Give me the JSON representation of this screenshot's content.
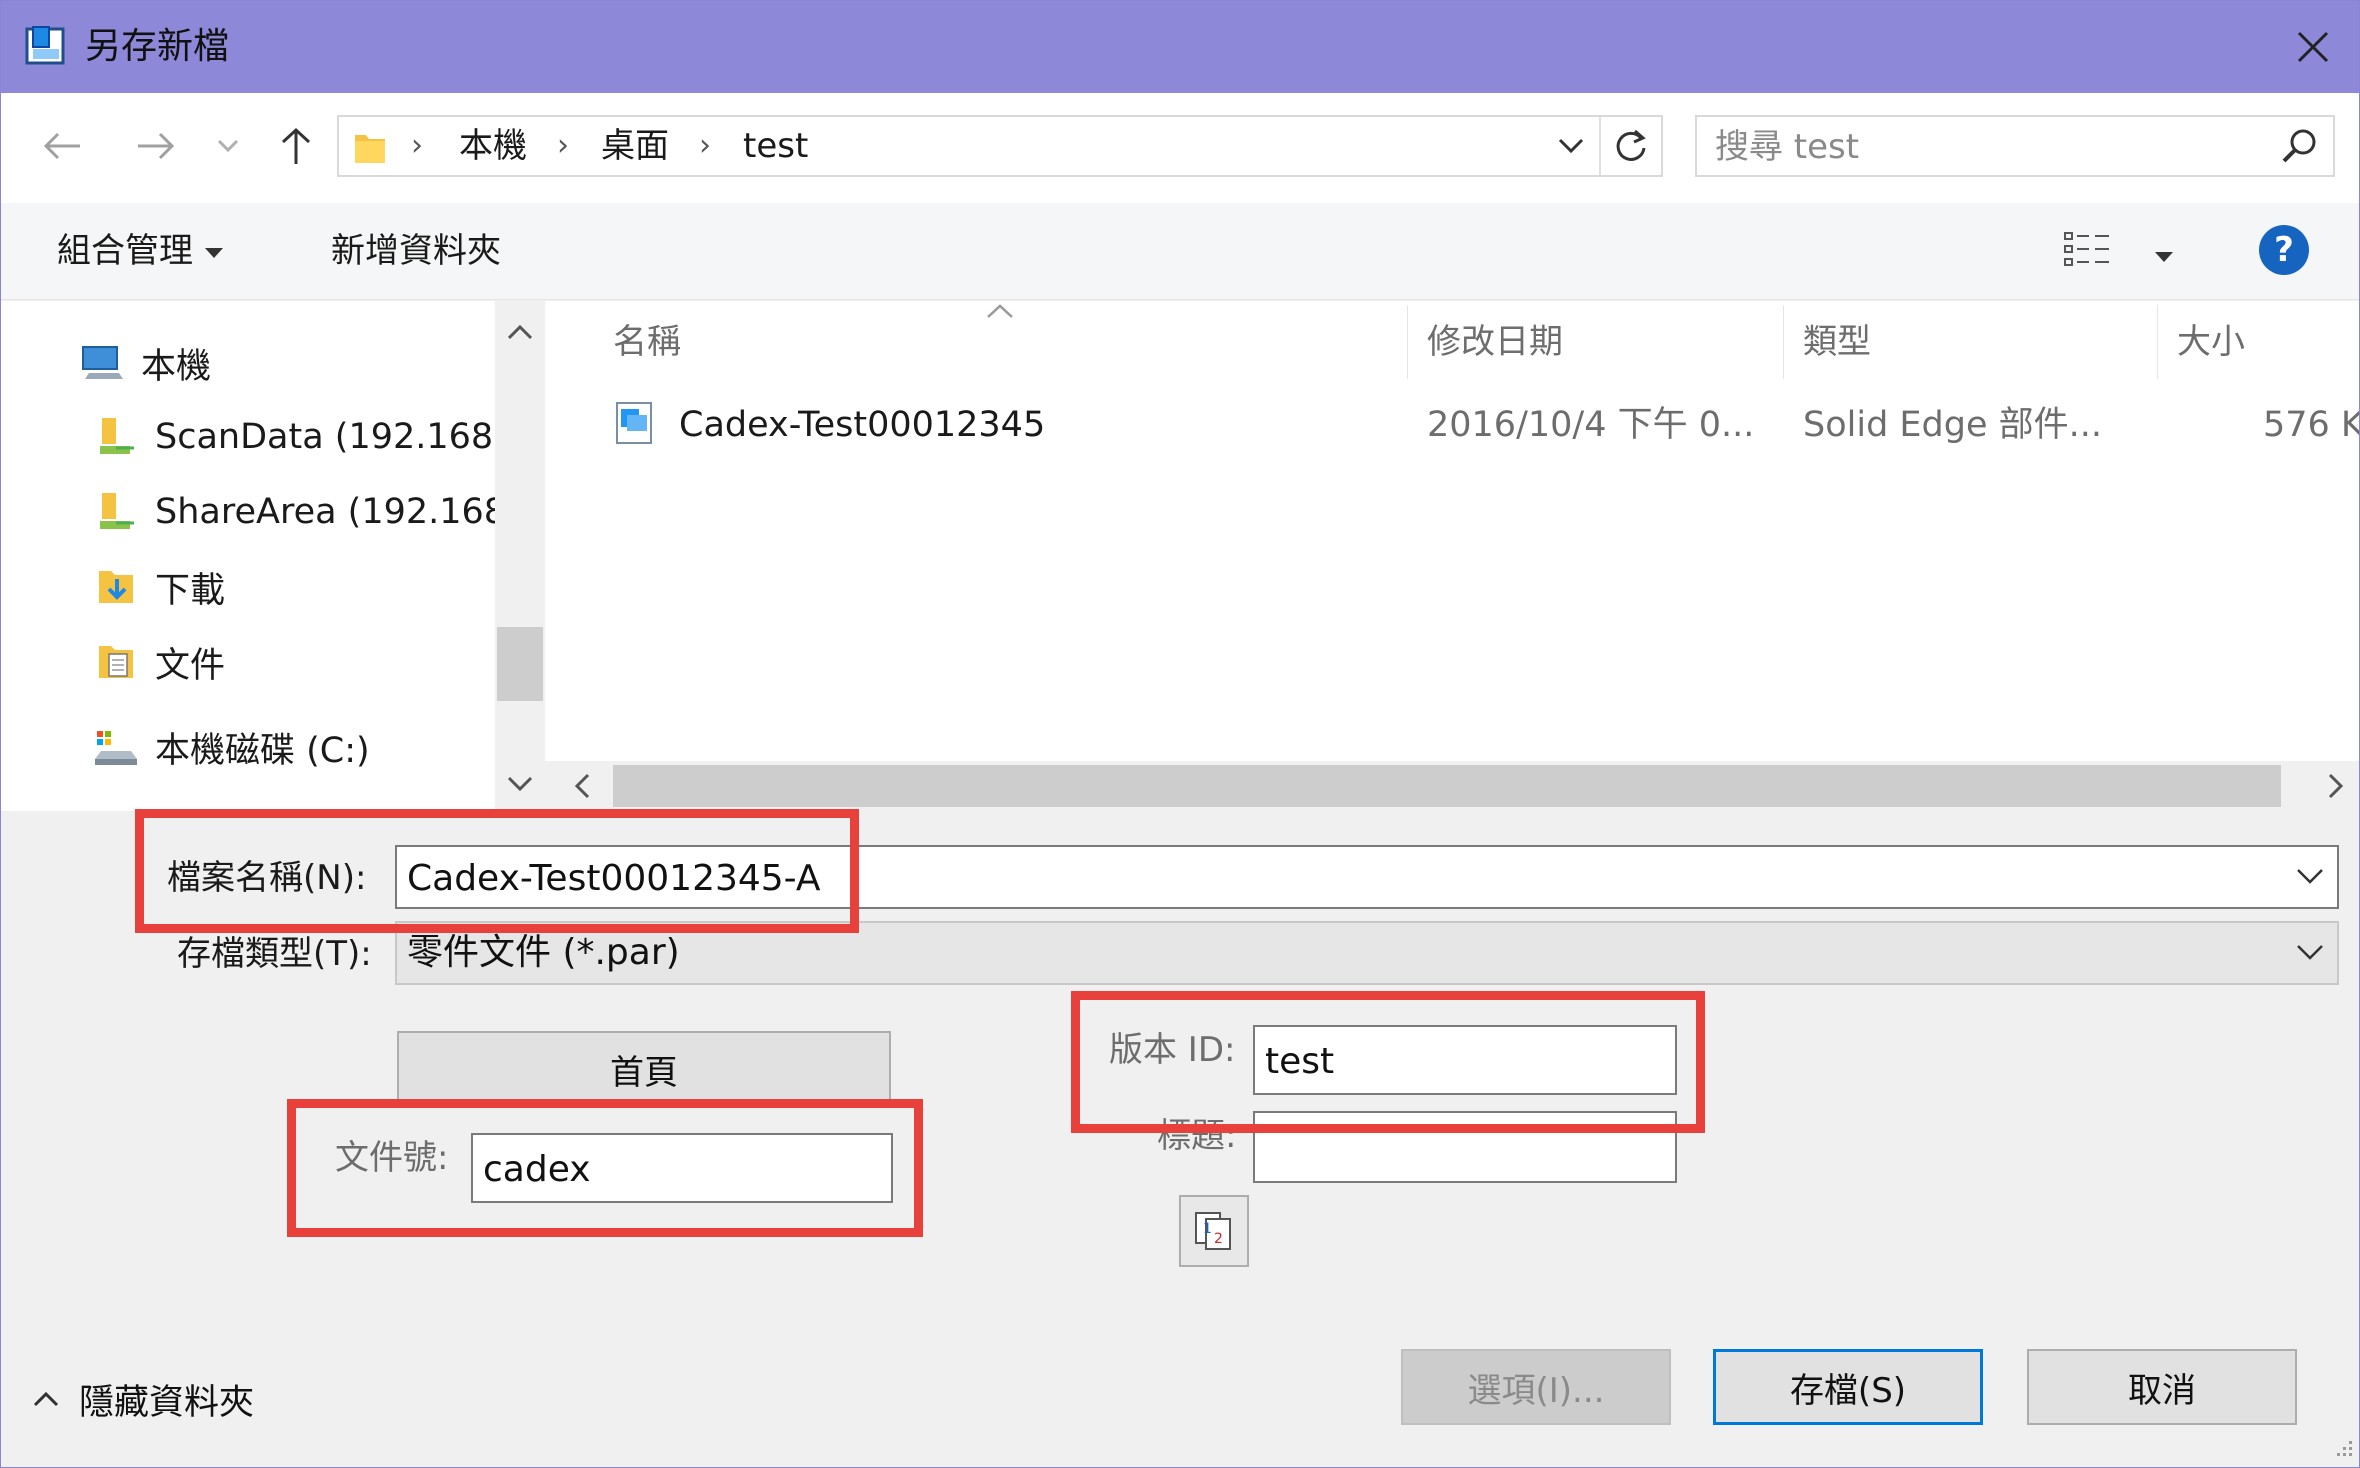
{
  "window": {
    "title": "另存新檔"
  },
  "address": {
    "crumbs": [
      "本機",
      "桌面",
      "test"
    ],
    "search_placeholder": "搜尋 test"
  },
  "toolbar": {
    "organize_label": "組合管理",
    "new_folder_label": "新增資料夾"
  },
  "nav_pane": {
    "items": [
      {
        "label": "本機",
        "icon": "computer-icon"
      },
      {
        "label": "ScanData (192.168.",
        "icon": "network-drive-icon"
      },
      {
        "label": "ShareArea (192.168.",
        "icon": "network-drive-icon"
      },
      {
        "label": "下載",
        "icon": "download-folder-icon"
      },
      {
        "label": "文件",
        "icon": "documents-folder-icon"
      },
      {
        "label": "本機磁碟 (C:)",
        "icon": "local-disk-icon"
      }
    ]
  },
  "file_list": {
    "columns": [
      "名稱",
      "修改日期",
      "類型",
      "大小"
    ],
    "rows": [
      {
        "name": "Cadex-Test00012345",
        "date": "2016/10/4 下午 0...",
        "type": "Solid Edge 部件...",
        "size": "576 K"
      }
    ]
  },
  "form": {
    "filename_label": "檔案名稱(N):",
    "filename_value": "Cadex-Test00012345-A",
    "filetype_label": "存檔類型(T):",
    "filetype_value": "零件文件 (*.par)",
    "home_button_label": "首頁",
    "doc_number_label": "文件號:",
    "doc_number_value": "cadex",
    "version_label": "版本 ID:",
    "version_value": "test",
    "title_label": "標題:",
    "title_value": ""
  },
  "footer": {
    "hide_folders_label": "隱藏資料夾",
    "options_label": "選項(I)...",
    "save_label": "存檔(S)",
    "cancel_label": "取消"
  },
  "colors": {
    "titlebar": "#8d88d8",
    "highlight": "#e8413c",
    "accent": "#0078d7"
  }
}
